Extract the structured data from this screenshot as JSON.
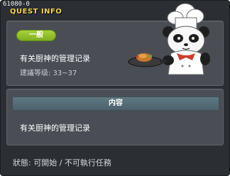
{
  "window": {
    "quest_id": "61080-0",
    "title": "QUEST INFO"
  },
  "quest": {
    "category": "一般",
    "name": "有关厨神的管理记录",
    "level_range": "建議等级: 33~37"
  },
  "content": {
    "header": "内容",
    "text": "有关厨神的管理记录"
  },
  "status": {
    "label": "狀態:",
    "value": "可開始 / 不可執行任務"
  },
  "colors": {
    "title": "#f3d34a",
    "badge": "#8fbe2a",
    "panel": "#4a4e54",
    "window": "#2b2e32"
  },
  "npc": {
    "icon": "panda-chef-icon"
  }
}
